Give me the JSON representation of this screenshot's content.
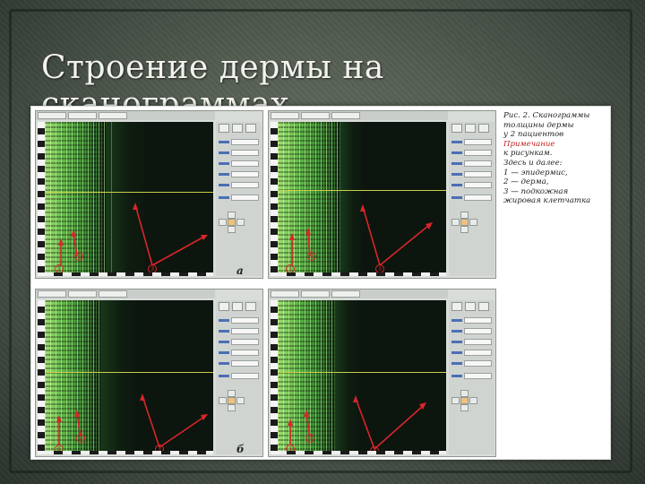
{
  "slide": {
    "title": "Строение дермы на сканограммах"
  },
  "figure": {
    "panels": [
      {
        "letter": "а"
      },
      {
        "letter": ""
      },
      {
        "letter": "б"
      },
      {
        "letter": ""
      }
    ],
    "marker_labels": [
      "1",
      "2",
      "3"
    ],
    "colors": {
      "tissue_bright": "#a6e27a",
      "background": "#0c150e",
      "arrow": "#d8262a",
      "scan_line": "#c9cf4a",
      "caption_red": "#c42020"
    }
  },
  "caption": {
    "line1": "Рис. 2. Сканограммы",
    "line2": "толщины дермы",
    "line3": "у 2 пациентов",
    "line4": "Примечание",
    "line5": "к рисункам.",
    "line6": "Здесь и далее:",
    "line7": "1 — эпидермис,",
    "line8": "2 — дерма,",
    "line9": "3 — подкожная",
    "line10": "жировая клетчатка"
  }
}
